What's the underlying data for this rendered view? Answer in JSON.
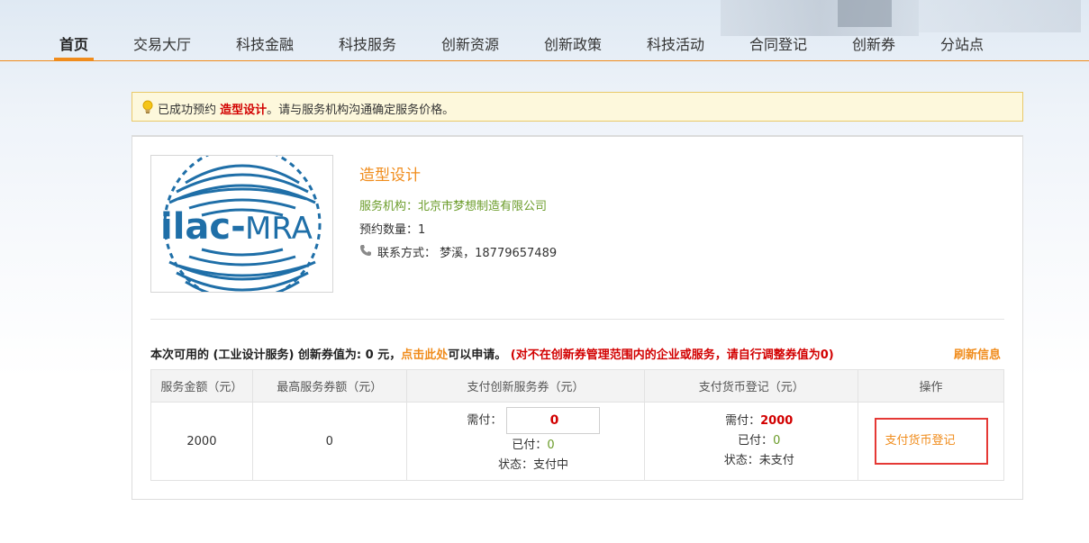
{
  "nav": {
    "items": [
      "首页",
      "交易大厅",
      "科技金融",
      "科技服务",
      "创新资源",
      "创新政策",
      "科技活动",
      "合同登记",
      "创新券",
      "分站点"
    ]
  },
  "notice": {
    "prefix": "已成功预约",
    "service": "造型设计",
    "suffix": "。请与服务机构沟通确定服务价格。"
  },
  "service": {
    "logo_text": "ilac-MRA",
    "title": "造型设计",
    "org": "服务机构：北京市梦想制造有限公司",
    "quantity": "预约数量：1",
    "contact": "联系方式： 梦溪，18779657489"
  },
  "voucher": {
    "avail_prefix": "本次可用的 (工业设计服务) 创新券值为: 0 元，",
    "avail_link": "点击此处",
    "avail_suffix": "可以申请。",
    "avail_warning": "(对不在创新券管理范围内的企业或服务，请自行调整券值为0)",
    "refresh": "刷新信息",
    "headers": [
      "服务金额（元）",
      "最高服务券额（元）",
      "支付创新服务券（元）",
      "支付货币登记（元）",
      "操作"
    ],
    "row": {
      "amount": "2000",
      "max_voucher": "0",
      "voucher_need_label": "需付：",
      "voucher_need_value": "0",
      "voucher_paid_label": "已付：",
      "voucher_paid_value": "0",
      "voucher_status": "状态：支付中",
      "cash_need_label": "需付：",
      "cash_need_value": "2000",
      "cash_paid_label": "已付：",
      "cash_paid_value": "0",
      "cash_status": "状态：未支付",
      "action": "支付货币登记"
    }
  },
  "colors": {
    "accent": "#f08c1c",
    "warning_red": "#d20000",
    "green": "#6b9c2a",
    "highlight_box": "#e53935"
  }
}
